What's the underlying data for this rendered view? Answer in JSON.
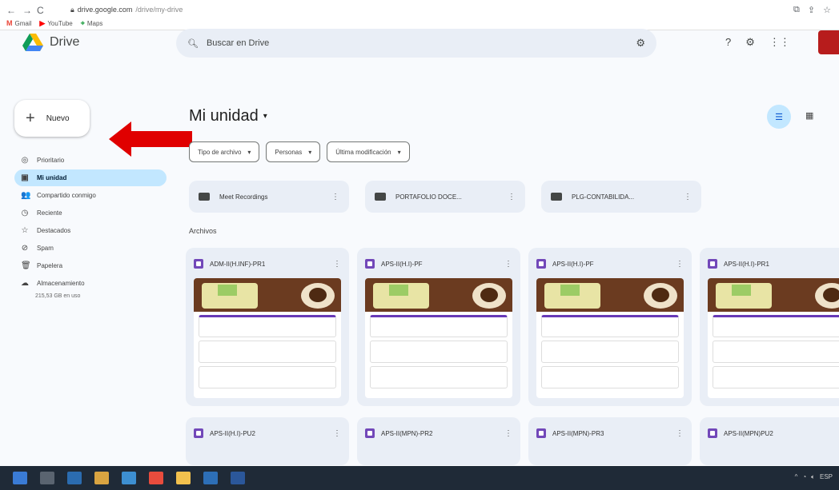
{
  "browser": {
    "url_domain": "drive.google.com",
    "url_path": "/drive/my-drive",
    "bookmarks": [
      {
        "label": "Gmail",
        "icon": "gmail-icon"
      },
      {
        "label": "YouTube",
        "icon": "youtube-icon"
      },
      {
        "label": "Maps",
        "icon": "maps-icon"
      }
    ]
  },
  "app": {
    "name": "Drive",
    "search_placeholder": "Buscar en Drive",
    "new_label": "Nuevo"
  },
  "sidebar": {
    "items": [
      {
        "label": "Prioritario",
        "icon": "priority-icon",
        "glyph": "◎"
      },
      {
        "label": "Mi unidad",
        "icon": "my-drive-icon",
        "glyph": "▣",
        "active": true
      },
      {
        "label": "Compartido conmigo",
        "icon": "shared-icon",
        "glyph": "👥"
      },
      {
        "label": "Reciente",
        "icon": "clock-icon",
        "glyph": "◷"
      },
      {
        "label": "Destacados",
        "icon": "star-icon",
        "glyph": "☆"
      },
      {
        "label": "Spam",
        "icon": "spam-icon",
        "glyph": "⊘"
      },
      {
        "label": "Papelera",
        "icon": "trash-icon",
        "glyph": "🗑"
      },
      {
        "label": "Almacenamiento",
        "icon": "cloud-icon",
        "glyph": "☁"
      }
    ],
    "storage_used": "215,53 GB en uso"
  },
  "main": {
    "title": "Mi unidad",
    "filters": [
      "Tipo de archivo",
      "Personas",
      "Última modificación"
    ],
    "folders": [
      "Meet Recordings",
      "PORTAFOLIO DOCE...",
      "PLG-CONTABILIDA..."
    ],
    "files_label": "Archivos",
    "files": [
      "ADM-II(H.INF)-PR1",
      "APS-II(H.I)-PF",
      "APS-II(H.I)-PF",
      "APS-II(H.I)-PR1",
      "APS-II(H.I)-PU2",
      "APS-II(MPN)-PR2",
      "APS-II(MPN)-PR3",
      "APS-II(MPN)PU2"
    ]
  },
  "colors": {
    "accent": "#c2e7ff",
    "arrow": "#e00000",
    "form": "#7248b9"
  }
}
